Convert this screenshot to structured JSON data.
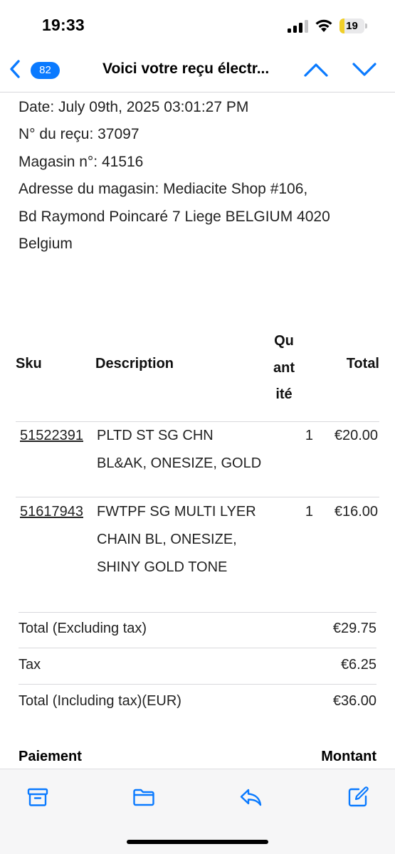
{
  "status_bar": {
    "time": "19:33",
    "battery_level": "19",
    "battery_fill_fraction": 0.19,
    "signal_bars_active": 3,
    "signal_bars_total": 4
  },
  "nav": {
    "unread_count": "82",
    "title": "Voici votre reçu électr...",
    "icons": [
      "chevron-left-icon",
      "chevron-up-icon",
      "chevron-down-icon"
    ]
  },
  "receipt": {
    "info_lines": [
      "Date: July 09th, 2025 03:01:27 PM",
      "N° du reçu: 37097",
      "Magasin n°: 41516",
      "Adresse du magasin: Mediacite Shop #106,",
      "Bd Raymond Poincaré 7 Liege BELGIUM 4020",
      "Belgium"
    ],
    "table": {
      "headers": {
        "sku": "Sku",
        "description": "Description",
        "quantity_lines": [
          "Qu",
          "ant",
          "ité"
        ],
        "total": "Total"
      },
      "rows": [
        {
          "sku": "51522391",
          "description_lines": [
            "PLTD ST SG CHN",
            "BL&AK, ONESIZE, GOLD"
          ],
          "quantity": "1",
          "total": "€20.00"
        },
        {
          "sku": "51617943",
          "description_lines": [
            "FWTPF SG MULTI LYER",
            "CHAIN BL, ONESIZE,",
            "SHINY GOLD TONE"
          ],
          "quantity": "1",
          "total": "€16.00"
        }
      ]
    },
    "totals": [
      {
        "label": "Total (Excluding tax)",
        "value": "€29.75"
      },
      {
        "label": "Tax",
        "value": "€6.25"
      },
      {
        "label": "Total (Including tax)(EUR)",
        "value": "€36.00"
      }
    ],
    "payment": {
      "label": "Paiement",
      "amount_label": "Montant"
    }
  },
  "toolbar": {
    "icons": [
      "archive-icon",
      "folder-icon",
      "reply-icon",
      "compose-icon"
    ]
  },
  "colors": {
    "accent": "#0a7aff",
    "battery": "#f0cf2a",
    "divider": "#d8d8dc"
  }
}
